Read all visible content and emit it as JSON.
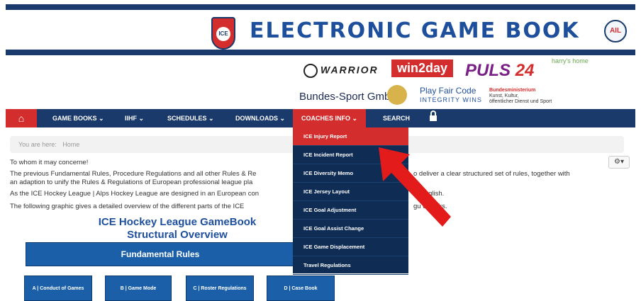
{
  "header": {
    "title": "ELECTRONIC GAME BOOK",
    "logo_text": "ICE",
    "league_logo_text": "AIL"
  },
  "sponsors": {
    "warrior": "WARRIOR",
    "win2day": "win2day",
    "puls_a": "PULS ",
    "puls_b": "24",
    "harrys": "harry's home",
    "bundes_sport": "Bundes-Sport GmbH",
    "play_fair": "Play Fair Code",
    "integrity": "INTEGRITY WINS",
    "ministry_a": "Bundesministerium",
    "ministry_b": "Kunst, Kultur,",
    "ministry_c": "öffentlicher Dienst und Sport"
  },
  "nav": {
    "items": [
      {
        "label": "GAME BOOKS ⌄"
      },
      {
        "label": "IIHF ⌄"
      },
      {
        "label": "SCHEDULES ⌄"
      },
      {
        "label": "DOWNLOADS ⌄"
      },
      {
        "label": "COACHES INFO ⌄"
      },
      {
        "label": "SEARCH"
      }
    ]
  },
  "breadcrumb": {
    "prefix": "You are here:",
    "home": "Home"
  },
  "content": {
    "greeting": "To whom it may concerne!",
    "para1_left": "The previous Fundamental Rules, Procedure Regulations and all other Rules & Re",
    "para1_right": "o deliver a clear structured set of rules, together with",
    "para1_line2": "an adaption to unify the Rules & Regulations of European professional league pla",
    "para2_left": "As the ICE Hockey League | Alps Hockey League are designed in an European con",
    "para2_right": "is English.",
    "para3_left": "The following graphic gives a detailed overview of the different parts of the ICE",
    "para3_right": "gu      eBooks.",
    "gamebook_title_1": "ICE Hockey League GameBook",
    "gamebook_title_2": "Structural Overview",
    "fundamental": "Fundamental Rules",
    "boxes": [
      {
        "label": "A | Conduct of Games"
      },
      {
        "label": "B | Game Mode"
      },
      {
        "label": "C | Roster Regulations"
      },
      {
        "label": "D | Case Book"
      }
    ]
  },
  "dropdown": {
    "items": [
      {
        "label": "ICE Injury Report"
      },
      {
        "label": "ICE Incident Report"
      },
      {
        "label": "ICE Diversity Memo"
      },
      {
        "label": "ICE Jersey Layout"
      },
      {
        "label": "ICE Goal Adjustment"
      },
      {
        "label": "ICE Goal Assist Change"
      },
      {
        "label": "ICE Game Displacement"
      },
      {
        "label": "Travel Regulations"
      }
    ]
  },
  "icons": {
    "home": "home-icon",
    "lock": "lock-icon",
    "gear": "gear-icon",
    "arrow": "arrow-annotation"
  },
  "colors": {
    "navy": "#1a3a6b",
    "red": "#d42d2d",
    "blue": "#1e4f9c"
  }
}
